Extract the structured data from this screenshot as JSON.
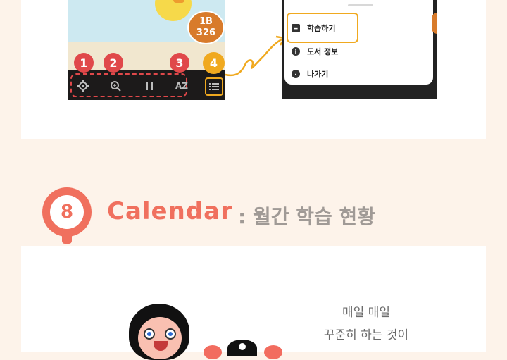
{
  "left_screen": {
    "score_label": "1B",
    "score_value": "326",
    "badges": [
      "1",
      "2",
      "3",
      "4"
    ],
    "toolbar": {
      "settings_icon": "gear-icon",
      "zoom_icon": "zoom-in-icon",
      "pause_icon": "pause-icon",
      "az_label": "AZ",
      "menu_icon": "list-icon"
    }
  },
  "right_screen": {
    "menu_items": [
      {
        "label": "학습하기",
        "icon": "notes-icon"
      },
      {
        "label": "도서 정보",
        "icon": "info-icon"
      },
      {
        "label": "나가기",
        "icon": "back-icon"
      }
    ]
  },
  "section": {
    "number": "8",
    "title_en": "Calendar",
    "title_ko": ": 월간 학습 현황"
  },
  "illustration": {
    "handwriting_lines": [
      "매일 매일",
      "꾸준히 하는 것이"
    ]
  },
  "colors": {
    "accent_coral": "#f0705e",
    "badge_red": "#e0484a",
    "badge_yellow": "#f0a91f",
    "title_gray": "#a09a96"
  }
}
